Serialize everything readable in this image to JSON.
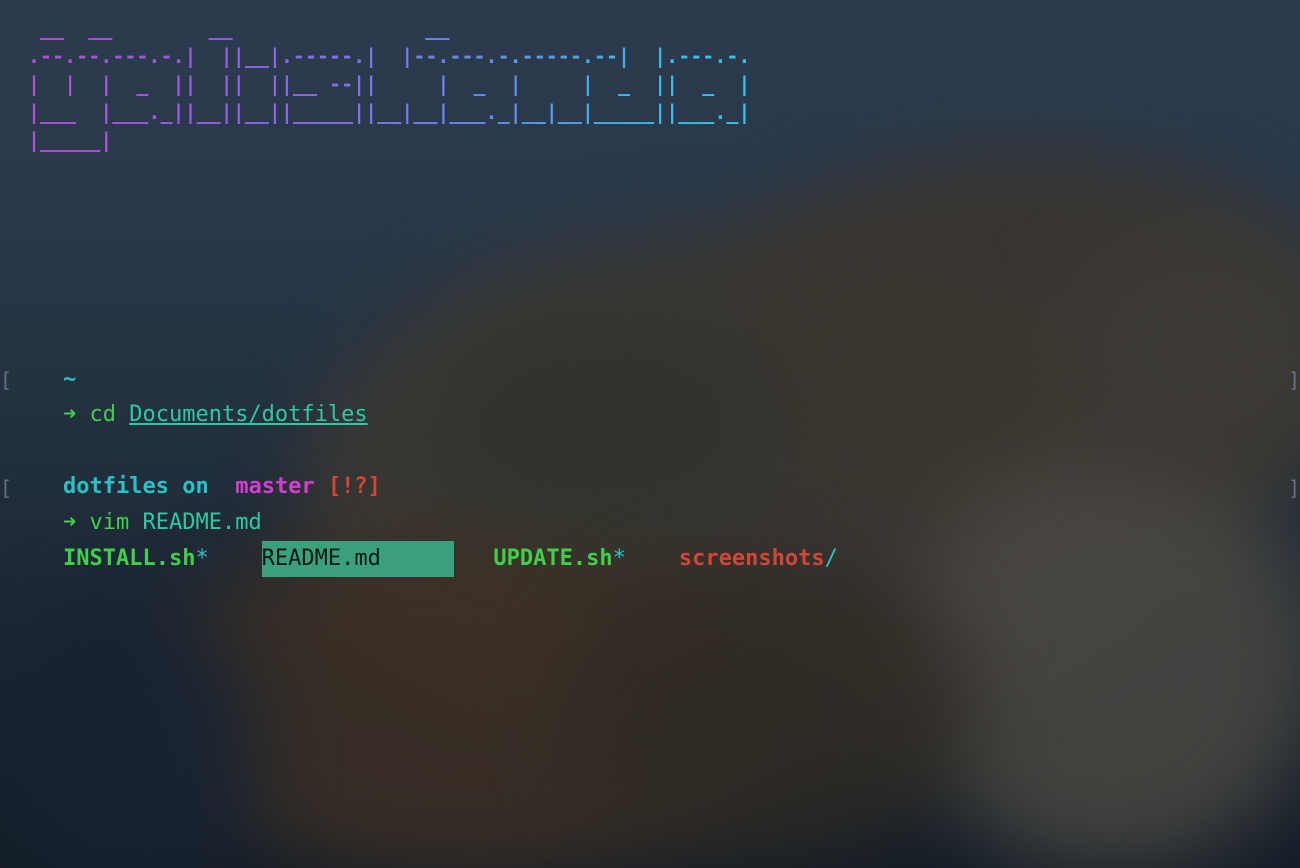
{
  "banner": " __  __        __                __\n.--.--.---.-.|  ||__|.-----.|  |--.---.-.-----.--|  |.---.-.\n|  |  |  _  ||  ||  ||__ --||     |  _  |     |  _  ||  _  |\n|___  |___._||__||__||_____||__|__|___._|__|__|_____||___._|\n|_____|",
  "prompt1": {
    "cwd": "~",
    "arrow": "➜",
    "command": "cd",
    "argument": "Documents/dotfiles"
  },
  "prompt2": {
    "dir": "dotfiles",
    "on": "on",
    "branch_icon": "",
    "branch": "master",
    "status": "[!?]",
    "arrow": "➜",
    "command": "vim",
    "argument": "README.md"
  },
  "listing": {
    "install": "INSTALL.sh",
    "install_mark": "*",
    "readme": "README.md",
    "update": "UPDATE.sh",
    "update_mark": "*",
    "screenshots": "screenshots",
    "screenshots_mark": "/"
  },
  "colors": {
    "accent_teal": "#28c2c5",
    "accent_green": "#3fcf4a",
    "accent_magenta": "#d23fd0",
    "accent_red": "#d2463a",
    "highlight": "#3aa07e"
  }
}
